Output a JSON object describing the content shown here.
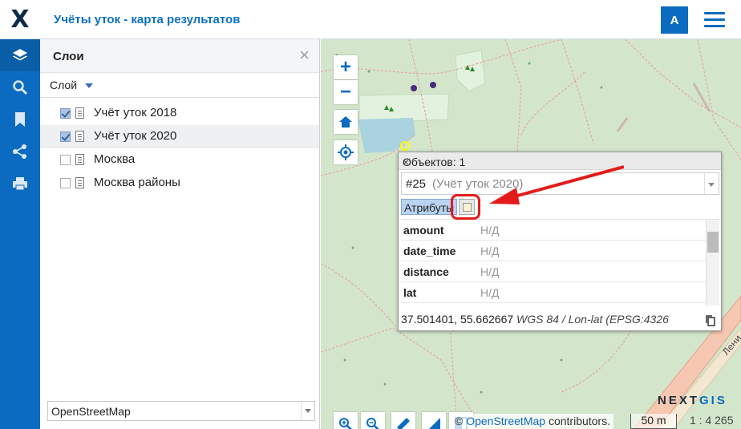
{
  "header": {
    "logo": "X",
    "title": "Учёты уток - карта результатов",
    "user_initial": "A",
    "colors": {
      "brand": "#0b6bc0"
    }
  },
  "sidebar": {
    "icons": [
      "layers-icon",
      "search-icon",
      "bookmark-icon",
      "share-icon",
      "print-icon"
    ]
  },
  "layers_panel": {
    "title": "Слои",
    "layer_menu_label": "Слой",
    "layers": [
      {
        "label": "Учёт уток 2018",
        "checked": true
      },
      {
        "label": "Учёт уток 2020",
        "checked": true
      },
      {
        "label": "Москва",
        "checked": false
      },
      {
        "label": "Москва районы",
        "checked": false
      }
    ],
    "basemap": "OpenStreetMap"
  },
  "identify_popup": {
    "title": "Объектов: 1",
    "feature_id": "#25",
    "feature_layer": "(Учёт уток 2020)",
    "tab_attributes": "Атрибуты",
    "attributes": [
      {
        "key": "amount",
        "value": "Н/Д"
      },
      {
        "key": "date_time",
        "value": "Н/Д"
      },
      {
        "key": "distance",
        "value": "Н/Д"
      },
      {
        "key": "lat",
        "value": "Н/Д"
      }
    ],
    "coords": "37.501401, 55.662667",
    "crs": "WGS 84 / Lon-lat (EPSG:4326"
  },
  "map": {
    "attribution_prefix": "©",
    "attribution_link": "OpenStreetMap",
    "attribution_suffix": "contributors.",
    "scale_label": "50 m",
    "scale_ratio": "1 : 4 265",
    "brand": "NEXTGIS",
    "street_label": "Лени"
  }
}
